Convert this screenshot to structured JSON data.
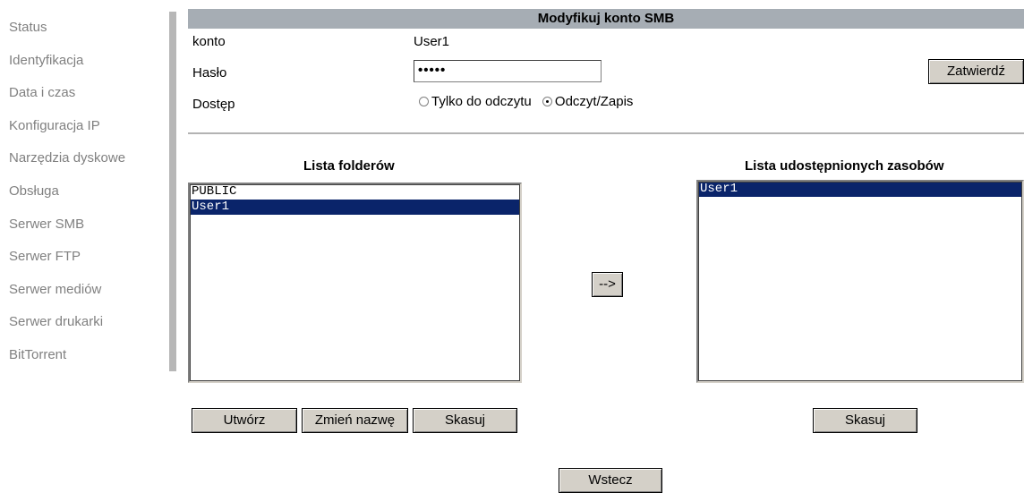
{
  "sidebar": {
    "items": [
      {
        "label": "Status"
      },
      {
        "label": "Identyfikacja"
      },
      {
        "label": "Data i czas"
      },
      {
        "label": "Konfiguracja IP"
      },
      {
        "label": "Narzędzia dyskowe"
      },
      {
        "label": "Obsługa"
      },
      {
        "label": "Serwer SMB"
      },
      {
        "label": "Serwer FTP"
      },
      {
        "label": "Serwer mediów"
      },
      {
        "label": "Serwer drukarki"
      },
      {
        "label": "BitTorrent"
      }
    ]
  },
  "header": {
    "title": "Modyfikuj konto SMB"
  },
  "form": {
    "account_label": "konto",
    "account_value": "User1",
    "password_label": "Hasło",
    "password_value": "•••••",
    "access_label": "Dostęp",
    "access_options": [
      {
        "label": "Tylko do odczytu",
        "checked": false
      },
      {
        "label": "Odczyt/Zapis",
        "checked": true
      }
    ],
    "submit_label": "Zatwierdź"
  },
  "folders": {
    "title": "Lista folderów",
    "items": [
      {
        "label": "PUBLIC",
        "selected": false
      },
      {
        "label": "User1",
        "selected": true
      }
    ],
    "create_label": "Utwórz",
    "rename_label": "Zmień nazwę",
    "delete_label": "Skasuj"
  },
  "transfer": {
    "label": "-->"
  },
  "shares": {
    "title": "Lista udostępnionych zasobów",
    "items": [
      {
        "label": "User1",
        "selected": true
      }
    ],
    "delete_label": "Skasuj"
  },
  "footer": {
    "back_label": "Wstecz"
  }
}
